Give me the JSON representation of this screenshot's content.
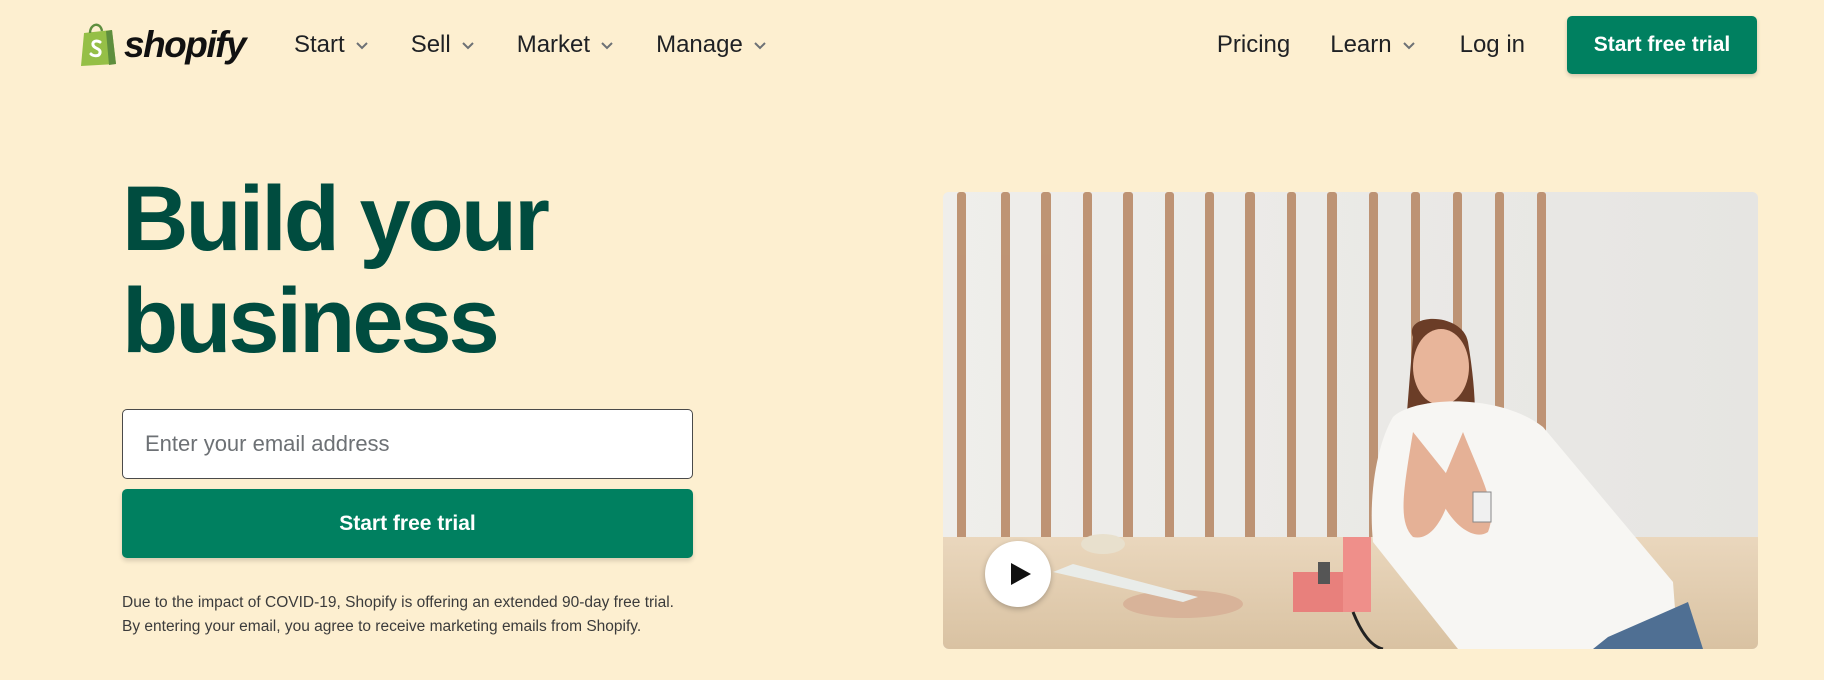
{
  "brand": {
    "name": "shopify",
    "logo_color": "#95bf47"
  },
  "nav": {
    "left_items": [
      {
        "label": "Start",
        "has_dropdown": true
      },
      {
        "label": "Sell",
        "has_dropdown": true
      },
      {
        "label": "Market",
        "has_dropdown": true
      },
      {
        "label": "Manage",
        "has_dropdown": true
      }
    ],
    "pricing": "Pricing",
    "learn": "Learn",
    "login": "Log in",
    "cta": "Start free trial"
  },
  "hero": {
    "headline_line1": "Build your",
    "headline_line2": "business",
    "email_placeholder": "Enter your email address",
    "email_value": "",
    "cta": "Start free trial",
    "disclaimer": "Due to the impact of COVID-19, Shopify is offering an extended 90-day free trial. By entering your email, you agree to receive marketing emails from Shopify.",
    "media": {
      "play_icon": "play-icon"
    }
  },
  "colors": {
    "background": "#fdefd0",
    "primary_green": "#008060",
    "headline_green": "#004c3f"
  }
}
